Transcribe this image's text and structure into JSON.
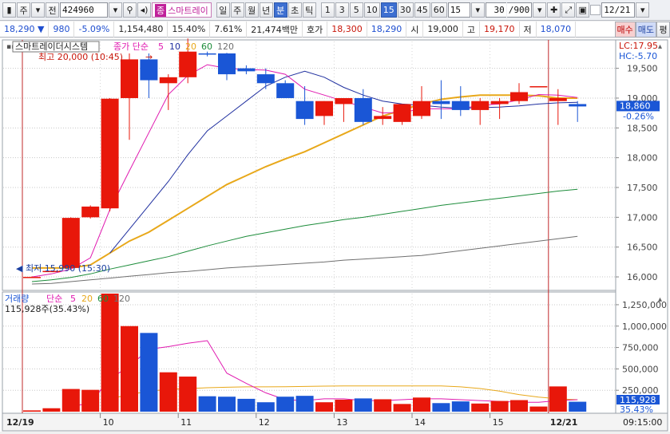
{
  "toolbar": {
    "market": "주",
    "jeon": "전",
    "code": "424960",
    "name_badge": "종",
    "name": "스마트레이",
    "periods": [
      "일",
      "주",
      "월",
      "년",
      "분",
      "초",
      "틱"
    ],
    "active_period": "분",
    "intervals": [
      "1",
      "3",
      "5",
      "10",
      "15",
      "30",
      "45",
      "60"
    ],
    "active_interval": "15",
    "interval_value": "15",
    "count": "30",
    "count_max": "/900",
    "date": "12/21"
  },
  "quote": {
    "price": "18,290",
    "change": "980",
    "change_pct": "-5.09%",
    "volume": "1,154,480",
    "turnover_pct": "15.40%",
    "ratio": "7.61%",
    "amount": "21,474백만",
    "hoga_label": "호가",
    "hoga_sell": "18,300",
    "hoga_buy": "18,290",
    "open_label": "시",
    "open": "19,000",
    "high_label": "고",
    "high": "19,170",
    "low_label": "저",
    "low": "18,070",
    "buy_label": "매수",
    "sell_label": "매도",
    "eval_label": "평"
  },
  "price_panel": {
    "stock_label": "스마트레이더시스템",
    "legend_prefix": "종가 단순",
    "ma_periods": [
      "5",
      "10",
      "20",
      "60",
      "120"
    ],
    "high_note": "최고 20,000 (10:45)",
    "low_note": "최저 15,990 (15:30)",
    "lc_label": "LC:17.95",
    "hc_label": "HC:-5.70",
    "current_price": "18,860",
    "current_pct": "-0.26%"
  },
  "volume_panel": {
    "label": "거래량",
    "legend_prefix": "단순",
    "ma_periods": [
      "5",
      "20",
      "60",
      "120"
    ],
    "info": "115,928주(35.43%)",
    "current_volume": "115,928",
    "current_pct": "35.43%"
  },
  "x_axis": {
    "left_date": "12/19",
    "right_date": "12/21",
    "time": "09:15:00"
  },
  "colors": {
    "up": "#e8170a",
    "down": "#1a56d6",
    "ma5": "#e01ab0",
    "ma10": "#1f2f9f",
    "ma20": "#e8a81a",
    "ma60": "#1c8c3a",
    "ma120": "#6f6f6f"
  },
  "chart_data": {
    "type": "candlestick",
    "price_axis": {
      "ticks": [
        16000,
        16500,
        17000,
        17500,
        18000,
        18500,
        19000,
        19500
      ],
      "range": [
        15800,
        19950
      ]
    },
    "volume_axis": {
      "ticks": [
        250000,
        500000,
        750000,
        1000000,
        1250000
      ],
      "tick_labels": [
        "250,000",
        "500,000",
        "750,000",
        "1,000,000",
        "1,250,000"
      ],
      "range": [
        0,
        1380000
      ]
    },
    "x_ticks": [
      {
        "index": 4,
        "label": "10"
      },
      {
        "index": 8,
        "label": "11"
      },
      {
        "index": 12,
        "label": "12"
      },
      {
        "index": 16,
        "label": "13"
      },
      {
        "index": 20,
        "label": "14"
      },
      {
        "index": 24,
        "label": "15"
      }
    ],
    "candles": [
      {
        "o": 15990,
        "h": 16010,
        "l": 15990,
        "c": 16000,
        "v": 15000
      },
      {
        "o": 16100,
        "h": 16100,
        "l": 16100,
        "c": 16100,
        "v": 40000
      },
      {
        "o": 16150,
        "h": 17000,
        "l": 16150,
        "c": 16990,
        "v": 265000
      },
      {
        "o": 17000,
        "h": 17200,
        "l": 16980,
        "c": 17180,
        "v": 255000
      },
      {
        "o": 17150,
        "h": 19000,
        "l": 17100,
        "c": 18990,
        "v": 1380000
      },
      {
        "o": 19000,
        "h": 19750,
        "l": 18300,
        "c": 19650,
        "v": 1000000
      },
      {
        "o": 19650,
        "h": 19750,
        "l": 19000,
        "c": 19300,
        "v": 920000
      },
      {
        "o": 19250,
        "h": 19400,
        "l": 18800,
        "c": 19350,
        "v": 460000
      },
      {
        "o": 19350,
        "h": 20000,
        "l": 19250,
        "c": 19780,
        "v": 410000
      },
      {
        "o": 19750,
        "h": 19780,
        "l": 19700,
        "c": 19730,
        "v": 180000
      },
      {
        "o": 19750,
        "h": 19760,
        "l": 19300,
        "c": 19400,
        "v": 175000
      },
      {
        "o": 19500,
        "h": 19550,
        "l": 19400,
        "c": 19450,
        "v": 150000
      },
      {
        "o": 19400,
        "h": 19500,
        "l": 19150,
        "c": 19250,
        "v": 110000
      },
      {
        "o": 19250,
        "h": 19300,
        "l": 19000,
        "c": 19000,
        "v": 175000
      },
      {
        "o": 18950,
        "h": 19200,
        "l": 18550,
        "c": 18650,
        "v": 185000
      },
      {
        "o": 18700,
        "h": 18950,
        "l": 18550,
        "c": 18950,
        "v": 110000
      },
      {
        "o": 18900,
        "h": 19000,
        "l": 18600,
        "c": 19000,
        "v": 140000
      },
      {
        "o": 19000,
        "h": 19150,
        "l": 18550,
        "c": 18600,
        "v": 155000
      },
      {
        "o": 18650,
        "h": 18850,
        "l": 18550,
        "c": 18700,
        "v": 145000
      },
      {
        "o": 18600,
        "h": 18900,
        "l": 18550,
        "c": 18900,
        "v": 90000
      },
      {
        "o": 18700,
        "h": 19200,
        "l": 18650,
        "c": 18950,
        "v": 165000
      },
      {
        "o": 18950,
        "h": 19300,
        "l": 18650,
        "c": 18900,
        "v": 100000
      },
      {
        "o": 18950,
        "h": 19200,
        "l": 18700,
        "c": 18800,
        "v": 120000
      },
      {
        "o": 18800,
        "h": 19000,
        "l": 18550,
        "c": 18950,
        "v": 95000
      },
      {
        "o": 18900,
        "h": 19000,
        "l": 18650,
        "c": 18950,
        "v": 125000
      },
      {
        "o": 18950,
        "h": 19250,
        "l": 18900,
        "c": 19100,
        "v": 135000
      },
      {
        "o": 19200,
        "h": 19200,
        "l": 19200,
        "c": 19200,
        "v": 60000
      },
      {
        "o": 18950,
        "h": 19150,
        "l": 18550,
        "c": 19000,
        "v": 295000
      },
      {
        "o": 18900,
        "h": 18950,
        "l": 18600,
        "c": 18860,
        "v": 115928
      }
    ],
    "ma_price": {
      "ma5": [
        16000,
        16050,
        16130,
        16320,
        17130,
        17780,
        18420,
        19060,
        19380,
        19560,
        19500,
        19480,
        19470,
        19400,
        19150,
        19050,
        18950,
        18850,
        18750,
        18760,
        18820,
        18820,
        18820,
        18880,
        18900,
        18970,
        19060,
        19050,
        19010
      ],
      "ma10": [
        null,
        null,
        null,
        null,
        16400,
        16800,
        17200,
        17600,
        18050,
        18450,
        18700,
        18950,
        19200,
        19350,
        19450,
        19350,
        19180,
        19050,
        18950,
        18900,
        18880,
        18850,
        18830,
        18840,
        18850,
        18870,
        18900,
        18920,
        18930
      ],
      "ma20": [
        16150,
        16150,
        16150,
        16200,
        16400,
        16600,
        16750,
        16950,
        17150,
        17350,
        17550,
        17700,
        17850,
        17980,
        18100,
        18250,
        18400,
        18550,
        18700,
        18800,
        18900,
        18980,
        19020,
        19050,
        19050,
        19050,
        19040,
        19000,
        19000
      ],
      "ma60": [
        15920,
        15950,
        15990,
        16050,
        16130,
        16200,
        16270,
        16340,
        16430,
        16520,
        16600,
        16680,
        16740,
        16800,
        16860,
        16910,
        16960,
        17000,
        17050,
        17100,
        17150,
        17200,
        17240,
        17280,
        17320,
        17360,
        17400,
        17440,
        17470
      ],
      "ma120": [
        15880,
        15890,
        15920,
        15950,
        15980,
        16010,
        16040,
        16070,
        16090,
        16120,
        16150,
        16170,
        16190,
        16210,
        16230,
        16250,
        16280,
        16300,
        16320,
        16340,
        16360,
        16400,
        16440,
        16480,
        16520,
        16560,
        16600,
        16640,
        16680
      ]
    },
    "ma_volume": {
      "ma5": [
        null,
        null,
        60000,
        100000,
        385000,
        530000,
        730000,
        760000,
        800000,
        830000,
        450000,
        330000,
        220000,
        140000,
        130000,
        150000,
        150000,
        130000,
        130000,
        140000,
        150000,
        150000,
        140000,
        130000,
        120000,
        110000,
        110000,
        130000,
        140000
      ],
      "ma20": [
        null,
        null,
        null,
        null,
        150000,
        200000,
        240000,
        260000,
        270000,
        280000,
        285000,
        290000,
        290000,
        292000,
        295000,
        298000,
        300000,
        300000,
        300000,
        300000,
        300000,
        300000,
        290000,
        270000,
        240000,
        200000,
        170000,
        150000,
        140000
      ]
    }
  }
}
